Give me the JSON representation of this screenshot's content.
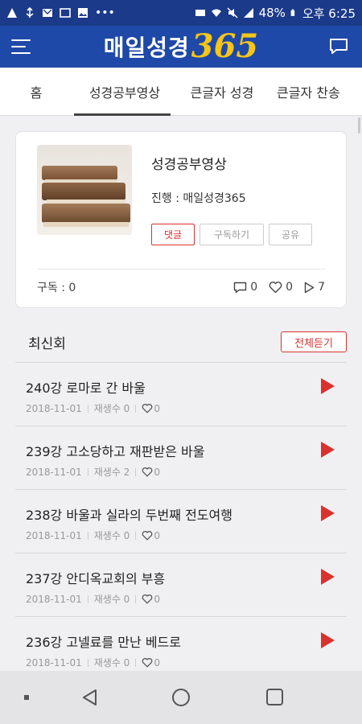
{
  "status_bar": {
    "battery": "48%",
    "time": "오후 6:25",
    "colors": {
      "background": "#1b3a8a"
    }
  },
  "header": {
    "logo_text": "매일성경",
    "logo_number": "365",
    "colors": {
      "background": "#1f49a8",
      "logo_number": "#f5c518"
    }
  },
  "tabs": [
    {
      "label": "홈",
      "active": false
    },
    {
      "label": "성경공부영상",
      "active": true
    },
    {
      "label": "큰글자 성경",
      "active": false
    },
    {
      "label": "큰글자 찬송",
      "active": false
    }
  ],
  "program": {
    "title": "성경공부영상",
    "host": "진행 : 매일성경365",
    "buttons": {
      "comment": "댓글",
      "subscribe": "구독하기",
      "share": "공유"
    },
    "subscribers": "구독 : 0",
    "comments": "0",
    "likes": "0",
    "plays": "7"
  },
  "latest": {
    "title": "최신회",
    "listen_all": "전체듣기",
    "items": [
      {
        "title": "240강 로마로 간 바울",
        "date": "2018-11-01",
        "plays": "재생수 0",
        "likes": "0"
      },
      {
        "title": "239강 고소당하고 재판받은 바울",
        "date": "2018-11-01",
        "plays": "재생수 2",
        "likes": "0"
      },
      {
        "title": "238강 바울과 실라의 두번째 전도여행",
        "date": "2018-11-01",
        "plays": "재생수 0",
        "likes": "0"
      },
      {
        "title": "237강 안디옥교회의 부흥",
        "date": "2018-11-01",
        "plays": "재생수 0",
        "likes": "0"
      },
      {
        "title": "236강 고넬료를 만난 베드로",
        "date": "2018-11-01",
        "plays": "재생수 0",
        "likes": "0"
      }
    ]
  },
  "colors": {
    "accent_red": "#d9322e"
  }
}
